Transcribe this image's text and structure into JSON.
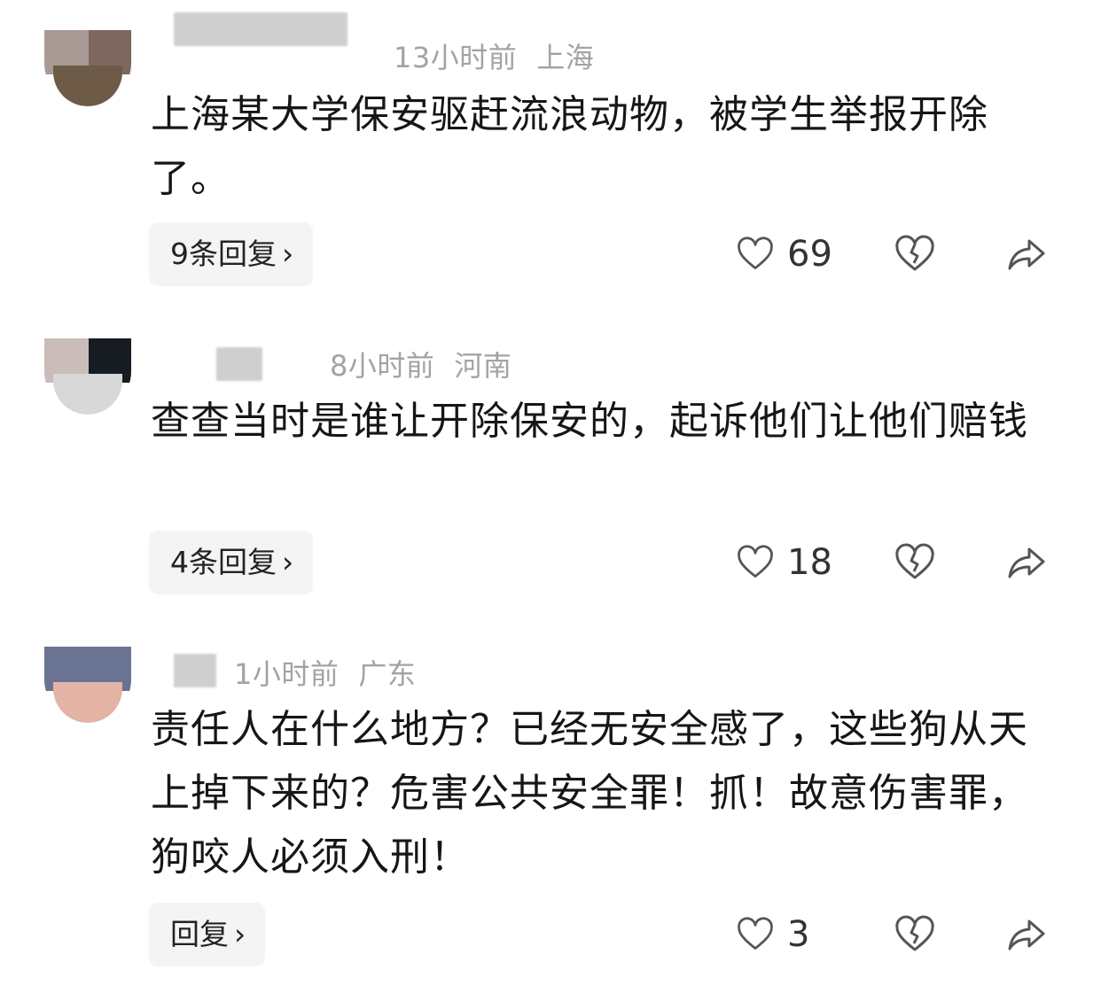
{
  "comments": [
    {
      "meta_time": "13小时前",
      "meta_location": "上海",
      "text": "上海某大学保安驱赶流浪动物，被学生举报开除了。",
      "reply_label": "9条回复",
      "like_count": "69"
    },
    {
      "meta_time": "8小时前",
      "meta_location": "河南",
      "text": "查查当时是谁让开除保安的，起诉他们让他们赔钱",
      "reply_label": "4条回复",
      "like_count": "18"
    },
    {
      "meta_time": "1小时前",
      "meta_location": "广东",
      "text": "责任人在什么地方？已经无安全感了，这些狗从天上掉下来的？危害公共安全罪！抓！故意伤害罪，狗咬人必须入刑！",
      "reply_label": "回复",
      "like_count": "3"
    }
  ],
  "icons": {
    "reply_chevron": "chevron-right-icon",
    "like": "heart-icon",
    "dislike": "broken-heart-icon",
    "share": "share-arrow-icon"
  },
  "colors": {
    "meta_text": "#a3a3a3",
    "body_text": "#161616",
    "reply_bg": "#f4f4f4",
    "icon_stroke": "#555555"
  }
}
